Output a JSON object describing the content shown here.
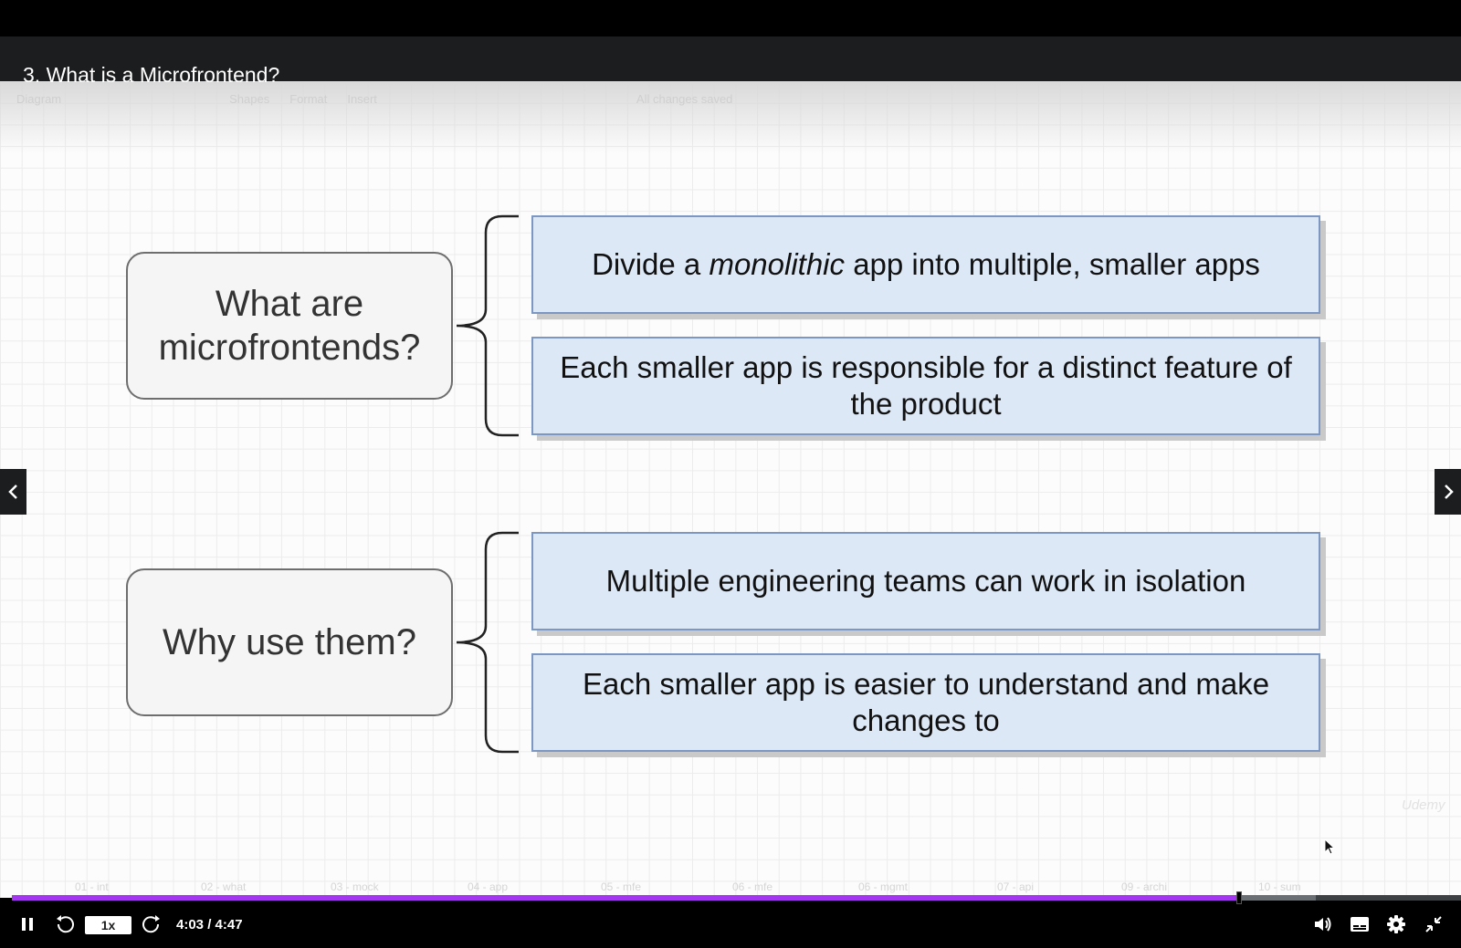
{
  "lecture": {
    "title": "3. What is a Microfrontend?"
  },
  "editor_ghost": {
    "menu": [
      "Diagram",
      "Shapes",
      "Format",
      "Insert"
    ],
    "status": "All changes saved"
  },
  "diagram": {
    "q1": {
      "line1": "What are",
      "line2": "microfrontends?"
    },
    "q2": {
      "text": "Why use them?"
    },
    "a1": {
      "prefix": "Divide a ",
      "emph": "monolithic",
      "suffix": " app into multiple, smaller apps"
    },
    "a2": {
      "text": "Each smaller app is responsible for a distinct feature of the product"
    },
    "a3": {
      "text": "Multiple engineering teams can work in isolation"
    },
    "a4": {
      "text": "Each smaller app is easier to understand and make changes to"
    }
  },
  "page_tabs": [
    "01 - int",
    "02 - what",
    "03 - mock",
    "04 - app",
    "05 - mfe",
    "06 - mfe",
    "06 - mgmt",
    "07 - api",
    "09 - archi",
    "10 - sum"
  ],
  "watermark": "Udemy",
  "player": {
    "speed": "1x",
    "time": "4:03 / 4:47",
    "progress_fraction": 0.8467,
    "buffered_fraction": 0.9
  },
  "icons": {
    "prev": "chevron-left-icon",
    "next": "chevron-right-icon",
    "pause": "pause-icon",
    "rewind": "rewind-icon",
    "forward": "forward-icon",
    "volume": "volume-icon",
    "captions": "captions-icon",
    "settings": "gear-icon",
    "exit_fullscreen": "exit-fullscreen-icon"
  },
  "colors": {
    "progress": "#a435f0",
    "answer_box_fill": "#dde8f7",
    "answer_box_border": "#7c97c1"
  }
}
